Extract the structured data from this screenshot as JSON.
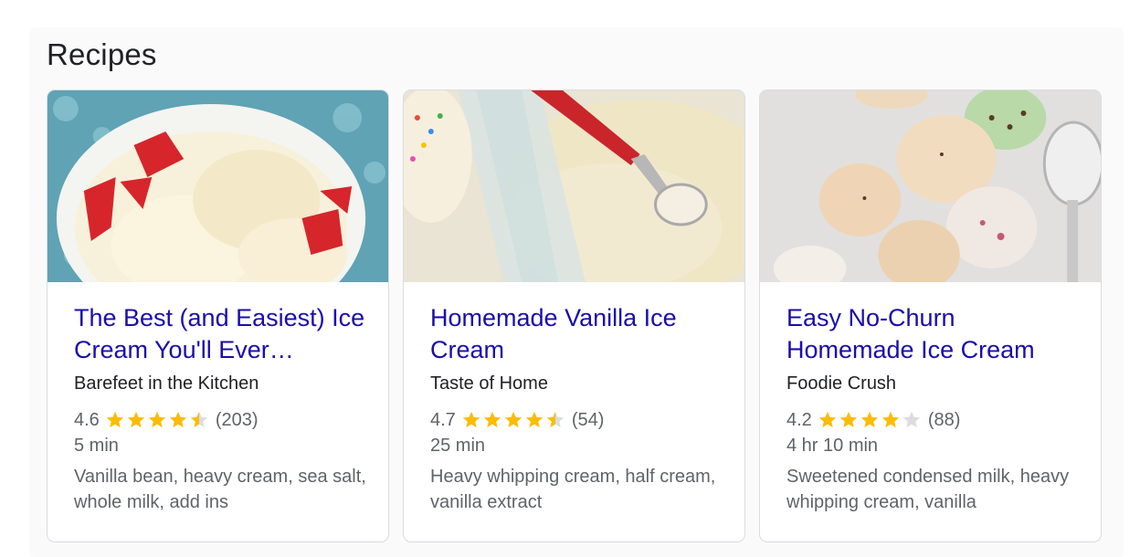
{
  "section": {
    "heading": "Recipes"
  },
  "cards": [
    {
      "title": "The Best (and Easiest) Ice Cream You'll Ever…",
      "source": "Barefeet in the Kitchen",
      "rating": "4.6",
      "rating_value": 4.6,
      "review_count": "(203)",
      "time": "5 min",
      "ingredients": "Vanilla bean, heavy cream, sea salt, whole milk, add ins"
    },
    {
      "title": "Homemade Vanilla Ice Cream",
      "source": "Taste of Home",
      "rating": "4.7",
      "rating_value": 4.7,
      "review_count": "(54)",
      "time": "25 min",
      "ingredients": "Heavy whipping cream, half cream, vanilla extract"
    },
    {
      "title": "Easy No-Churn Homemade Ice Cream",
      "source": "Foodie Crush",
      "rating": "4.2",
      "rating_value": 4.2,
      "review_count": "(88)",
      "time": "4 hr 10 min",
      "ingredients": "Sweetened condensed milk, heavy whipping cream, vanilla"
    }
  ],
  "colors": {
    "link": "#1a0dab",
    "star_filled": "#fbbc04",
    "star_empty": "#dadce0",
    "muted_text": "#5f6368"
  }
}
